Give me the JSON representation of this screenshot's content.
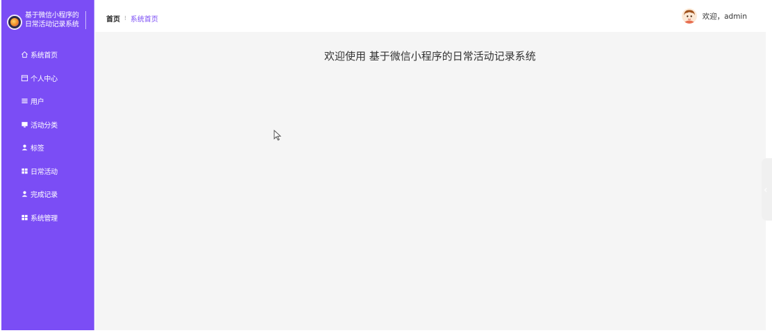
{
  "brand": {
    "title": "基于微信小程序的日常活动记录系统"
  },
  "sidebar": {
    "items": [
      {
        "label": "系统首页",
        "icon": "home-icon"
      },
      {
        "label": "个人中心",
        "icon": "calendar-icon"
      },
      {
        "label": "用户",
        "icon": "list-icon"
      },
      {
        "label": "活动分类",
        "icon": "monitor-icon"
      },
      {
        "label": "标签",
        "icon": "user-icon"
      },
      {
        "label": "日常活动",
        "icon": "grid-icon"
      },
      {
        "label": "完成记录",
        "icon": "user-icon"
      },
      {
        "label": "系统管理",
        "icon": "grid-icon"
      }
    ]
  },
  "header": {
    "breadcrumb_home": "首页",
    "breadcrumb_sep": "⁝",
    "breadcrumb_current": "系统首页",
    "greeting": "欢迎，admin"
  },
  "main": {
    "welcome": "欢迎使用 基于微信小程序的日常活动记录系统"
  },
  "colors": {
    "sidebar_bg": "#7b4df5",
    "accent": "#7b4df5",
    "content_bg": "#f5f5f5"
  }
}
